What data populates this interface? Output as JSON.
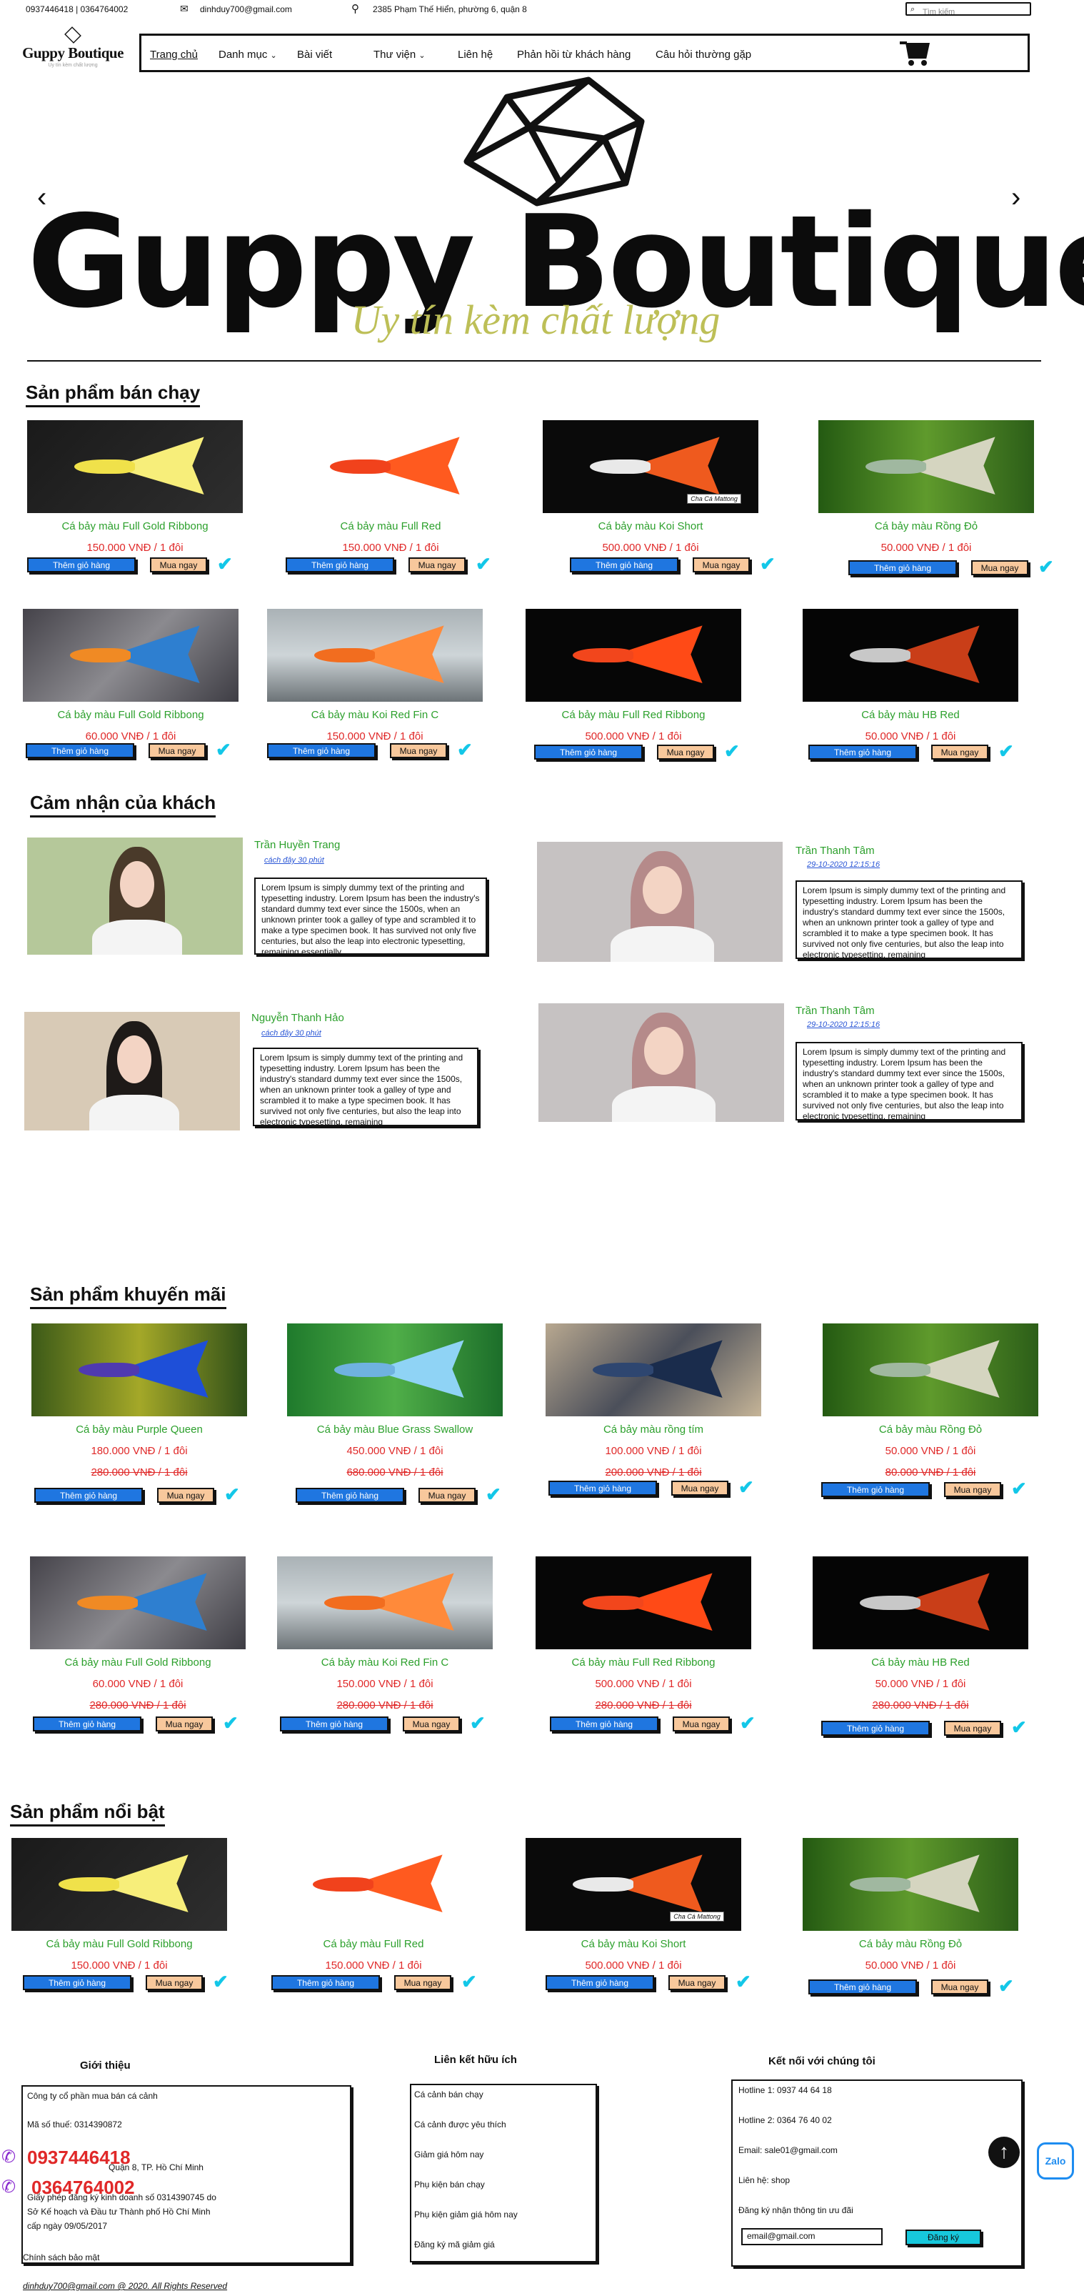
{
  "topbar": {
    "phones": "0937446418 | 0364764002",
    "email": "dinhduy700@gmail.com",
    "address": "2385 Phạm Thế Hiển, phường 6, quận 8",
    "search_placeholder": "Tìm kiếm"
  },
  "logo": {
    "name": "Guppy Boutique",
    "sub": "Uy tín kèm chất lượng"
  },
  "nav": {
    "items": [
      "Trang chủ",
      "Danh mục",
      "Bài viết",
      "Thư viện",
      "Liên hệ",
      "Phản hồi từ khách hàng",
      "Câu hỏi thường gặp"
    ]
  },
  "banner": {
    "brand": "Guppy Boutique",
    "slogan": "Uy tín kèm chất lượng",
    "prev": "‹",
    "next": "›"
  },
  "buttons": {
    "add_to_cart": "Thêm giỏ hàng",
    "buy_now": "Mua ngay",
    "check": "✔"
  },
  "bestsellers": {
    "title": "Sản phẩm bán chạy",
    "products": [
      {
        "name": "Cá bảy màu Full Gold Ribbong",
        "price": "150.000 VNĐ / 1 đôi"
      },
      {
        "name": "Cá bảy màu Full Red",
        "price": "150.000 VNĐ / 1 đôi"
      },
      {
        "name": "Cá bảy màu Koi Short",
        "price": "500.000 VNĐ / 1 đôi",
        "caption": "Cha Cá Mattong"
      },
      {
        "name": "Cá bảy màu Rồng Đỏ",
        "price": "50.000 VNĐ / 1 đôi"
      },
      {
        "name": "Cá bảy màu Full Gold Ribbong",
        "price": "60.000 VNĐ / 1 đôi"
      },
      {
        "name": "Cá bảy màu Koi Red Fin C",
        "price": "150.000 VNĐ / 1 đôi"
      },
      {
        "name": "Cá bảy màu Full Red Ribbong",
        "price": "500.000 VNĐ / 1 đôi"
      },
      {
        "name": "Cá bảy màu HB Red",
        "price": "50.000 VNĐ / 1 đôi"
      }
    ]
  },
  "reviews": {
    "title": "Cảm nhận của khách",
    "items": [
      {
        "name": "Trần Huyền Trang",
        "time": "cách đây 30 phút",
        "text": "Lorem Ipsum is simply dummy text of the printing and typesetting industry. Lorem Ipsum has been the industry's standard dummy text ever since the 1500s, when an unknown printer took a galley of type and scrambled it to make a type specimen book. It has survived not only five centuries, but also the leap into electronic typesetting, remaining essentially"
      },
      {
        "name": "Trần Thanh Tâm",
        "time": "29-10-2020 12:15:16",
        "text": "Lorem Ipsum is simply dummy text of the printing and typesetting industry. Lorem Ipsum has been the industry's standard dummy text ever since the 1500s, when an unknown printer took a galley of type and scrambled it to make a type specimen book. It has survived not only five centuries, but also the leap into electronic typesetting, remaining"
      },
      {
        "name": "Nguyễn Thanh Hảo",
        "time": "cách đây 30 phút",
        "text": "Lorem Ipsum is simply dummy text of the printing and typesetting industry. Lorem Ipsum has been the industry's standard dummy text ever since the 1500s, when an unknown printer took a galley of type and scrambled it to make a type specimen book. It has survived not only five centuries, but also the leap into electronic typesetting, remaining"
      },
      {
        "name": "Trần Thanh Tâm",
        "time": "29-10-2020 12:15:16",
        "text": "Lorem Ipsum is simply dummy text of the printing and typesetting industry. Lorem Ipsum has been the industry's standard dummy text ever since the 1500s, when an unknown printer took a galley of type and scrambled it to make a type specimen book. It has survived not only five centuries, but also the leap into electronic typesetting, remaining"
      }
    ]
  },
  "promotions": {
    "title": "Sản phẩm khuyến mãi",
    "products": [
      {
        "name": "Cá bảy màu Purple Queen",
        "price": "180.000 VNĐ / 1 đôi",
        "old_price": "280.000 VNĐ / 1 đôi"
      },
      {
        "name": "Cá bảy màu Blue Grass Swallow",
        "price": "450.000 VNĐ / 1 đôi",
        "old_price": "680.000 VNĐ / 1 đôi"
      },
      {
        "name": "Cá bảy màu rồng tím",
        "price": "100.000 VNĐ / 1 đôi",
        "old_price": "200.000 VNĐ / 1 đôi"
      },
      {
        "name": "Cá bảy màu Rồng Đỏ",
        "price": "50.000 VNĐ / 1 đôi",
        "old_price": "80.000 VNĐ / 1 đôi"
      },
      {
        "name": "Cá bảy màu Full Gold Ribbong",
        "price": "60.000 VNĐ / 1 đôi",
        "old_price": "280.000 VNĐ / 1 đôi"
      },
      {
        "name": "Cá bảy màu Koi Red Fin C",
        "price": "150.000 VNĐ / 1 đôi",
        "old_price": "280.000 VNĐ / 1 đôi"
      },
      {
        "name": "Cá bảy màu Full Red Ribbong",
        "price": "500.000 VNĐ / 1 đôi",
        "old_price": "280.000 VNĐ / 1 đôi"
      },
      {
        "name": "Cá bảy màu HB Red",
        "price": "50.000 VNĐ / 1 đôi",
        "old_price": "280.000 VNĐ / 1 đôi"
      }
    ]
  },
  "featured": {
    "title": "Sản phẩm nổi bật",
    "products": [
      {
        "name": "Cá bảy màu Full Gold Ribbong",
        "price": "150.000 VNĐ / 1 đôi"
      },
      {
        "name": "Cá bảy màu Full Red",
        "price": "150.000 VNĐ / 1 đôi"
      },
      {
        "name": "Cá bảy màu Koi Short",
        "price": "500.000 VNĐ / 1 đôi",
        "caption": "Cha Cá Mattong"
      },
      {
        "name": "Cá bảy màu Rồng Đỏ",
        "price": "50.000 VNĐ / 1 đôi"
      }
    ]
  },
  "footer": {
    "intro_title": "Giới thiệu",
    "intro_lines": [
      "Công ty cổ phần mua bán cá cảnh",
      "Mã số thuế: 0314390872",
      "Quận 8, TP. Hồ Chí Minh",
      "Giấy phép đăng ký kinh doanh số 0314390745 do",
      "Sở Kế hoạch và Đầu tư Thành phố Hồ Chí Minh",
      "cấp ngày 09/05/2017",
      "Chính sách bảo mật"
    ],
    "phone1": "0937446418",
    "phone2": "0364764002",
    "links_title": "Liên kết hữu ích",
    "links": [
      "Cá cảnh bán chạy",
      "Cá cảnh được yêu thích",
      "Giảm giá hôm nay",
      "Phụ kiện bán chạy",
      "Phụ kiện giảm giá hôm nay",
      "Đăng ký mã giảm giá"
    ],
    "connect_title": "Kết nối với chúng tôi",
    "connect": [
      "Hotline 1: 0937 44 64 18",
      "Hotline 2: 0364 76 40 02",
      "Email: sale01@gmail.com",
      "Liên hệ: shop",
      "Đăng ký nhận thông tin ưu đãi"
    ],
    "email_input": "email@gmail.com",
    "subscribe": "Đăng ký",
    "copyright": "dinhduy700@gmail.com @ 2020. All Rights Reserved",
    "zalo": "Zalo",
    "scroll_top": "↑"
  }
}
